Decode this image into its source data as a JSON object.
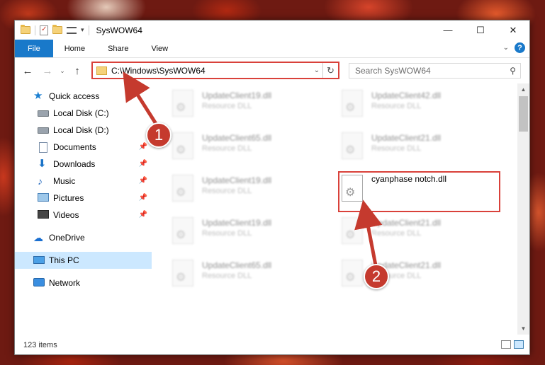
{
  "window": {
    "title": "SysWOW64",
    "minimize": "—",
    "maximize": "☐",
    "close": "✕"
  },
  "ribbon": {
    "tabs": [
      "File",
      "Home",
      "Share",
      "View"
    ],
    "collapse_chevron": "⌄",
    "help": "?"
  },
  "nav": {
    "back": "←",
    "forward": "→",
    "recent": "⌄",
    "up": "↑"
  },
  "address": {
    "path": "C:\\Windows\\SysWOW64",
    "dropdown": "⌄",
    "refresh": "↻"
  },
  "search": {
    "placeholder": "Search SysWOW64",
    "icon": "search-icon"
  },
  "sidebar": {
    "items": [
      {
        "label": "Quick access",
        "icon": "star-icon",
        "pinned": false
      },
      {
        "label": "Local Disk (C:)",
        "icon": "disk-icon",
        "pinned": true
      },
      {
        "label": "Local Disk (D:)",
        "icon": "disk-icon",
        "pinned": true
      },
      {
        "label": "Documents",
        "icon": "documents-icon",
        "pinned": true
      },
      {
        "label": "Downloads",
        "icon": "downloads-icon",
        "pinned": true
      },
      {
        "label": "Music",
        "icon": "music-icon",
        "pinned": true
      },
      {
        "label": "Pictures",
        "icon": "pictures-icon",
        "pinned": true
      },
      {
        "label": "Videos",
        "icon": "videos-icon",
        "pinned": true
      },
      {
        "label": "OneDrive",
        "icon": "onedrive-icon",
        "pinned": false
      },
      {
        "label": "This PC",
        "icon": "this-pc-icon",
        "pinned": false,
        "selected": true
      },
      {
        "label": "Network",
        "icon": "network-icon",
        "pinned": false
      }
    ]
  },
  "files": [
    {
      "name": "UpdateClient19.dll",
      "type": "Resource DLL"
    },
    {
      "name": "UpdateClient42.dll",
      "type": "Resource DLL"
    },
    {
      "name": "UpdateClient65.dll",
      "type": "Resource DLL"
    },
    {
      "name": "UpdateClient21.dll",
      "type": "Resource DLL"
    },
    {
      "name": "UpdateClient19.dll",
      "type": "Resource DLL"
    },
    {
      "name": "cyanphase notch.dll",
      "type": ""
    },
    {
      "name": "UpdateClient19.dll",
      "type": "Resource DLL"
    },
    {
      "name": "UpdateClient21.dll",
      "type": "Resource DLL"
    },
    {
      "name": "UpdateClient65.dll",
      "type": "Resource DLL"
    },
    {
      "name": "UpdateClient21.dll",
      "type": "Resource DLL"
    }
  ],
  "status": {
    "item_count": "123 items"
  },
  "annotations": {
    "step1": "1",
    "step2": "2",
    "color": "#c53a2e"
  }
}
